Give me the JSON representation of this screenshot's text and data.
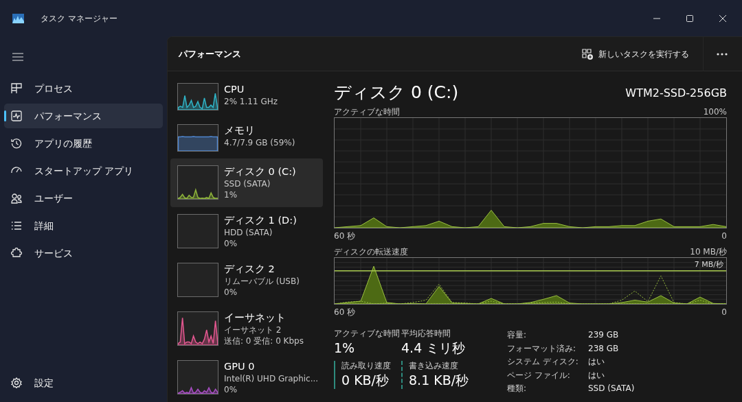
{
  "window": {
    "title": "タスク マネージャー"
  },
  "sidebar": {
    "items": [
      {
        "label": "プロセス",
        "selected": false
      },
      {
        "label": "パフォーマンス",
        "selected": true
      },
      {
        "label": "アプリの履歴",
        "selected": false
      },
      {
        "label": "スタートアップ アプリ",
        "selected": false
      },
      {
        "label": "ユーザー",
        "selected": false
      },
      {
        "label": "詳細",
        "selected": false
      },
      {
        "label": "サービス",
        "selected": false
      }
    ],
    "footer": {
      "label": "設定"
    }
  },
  "page": {
    "title": "パフォーマンス",
    "action": "新しいタスクを実行する"
  },
  "devices": [
    {
      "name": "CPU",
      "lines": [
        "2%  1.11 GHz"
      ],
      "color": "#2fb3c6",
      "selected": false
    },
    {
      "name": "メモリ",
      "lines": [
        "4.7/7.9 GB (59%)"
      ],
      "color": "#4f86d0",
      "selected": false
    },
    {
      "name": "ディスク 0 (C:)",
      "lines": [
        "SSD (SATA)",
        "1%"
      ],
      "color": "#8db33a",
      "selected": true
    },
    {
      "name": "ディスク 1 (D:)",
      "lines": [
        "HDD (SATA)",
        "0%"
      ],
      "selected": false
    },
    {
      "name": "ディスク 2",
      "lines": [
        "リムーバブル (USB)",
        "0%"
      ],
      "selected": false
    },
    {
      "name": "イーサネット",
      "lines": [
        "イーサネット 2",
        "送信: 0 受信: 0 Kbps"
      ],
      "color": "#e2578f",
      "selected": false
    },
    {
      "name": "GPU 0",
      "lines": [
        "Intel(R) UHD Graphic...",
        "0%"
      ],
      "color": "#a74dc2",
      "selected": false
    }
  ],
  "detail": {
    "title": "ディスク 0 (C:)",
    "model": "WTM2-SSD-256GB",
    "graphs": [
      {
        "title": "アクティブな時間",
        "max_label": "100%",
        "time_label": "60 秒",
        "end_label": "0"
      },
      {
        "title": "ディスクの転送速度",
        "max_label": "10 MB/秒",
        "threshold_label": "7 MB/秒",
        "time_label": "60 秒",
        "end_label": "0"
      }
    ],
    "stats": [
      {
        "label": "アクティブな時間",
        "value": "1%"
      },
      {
        "label": "平均応答時間",
        "value": "4.4 ミリ秒"
      }
    ],
    "rates": [
      {
        "label": "読み取り速度",
        "value": "0 KB/秒",
        "kind": "solid"
      },
      {
        "label": "書き込み速度",
        "value": "8.1 KB/秒",
        "kind": "dashed"
      }
    ],
    "properties": [
      {
        "key": "容量:",
        "value": "239 GB"
      },
      {
        "key": "フォーマット済み:",
        "value": "238 GB"
      },
      {
        "key": "システム ディスク:",
        "value": "はい"
      },
      {
        "key": "ページ ファイル:",
        "value": "はい"
      },
      {
        "key": "種類:",
        "value": "SSD (SATA)"
      }
    ]
  }
}
